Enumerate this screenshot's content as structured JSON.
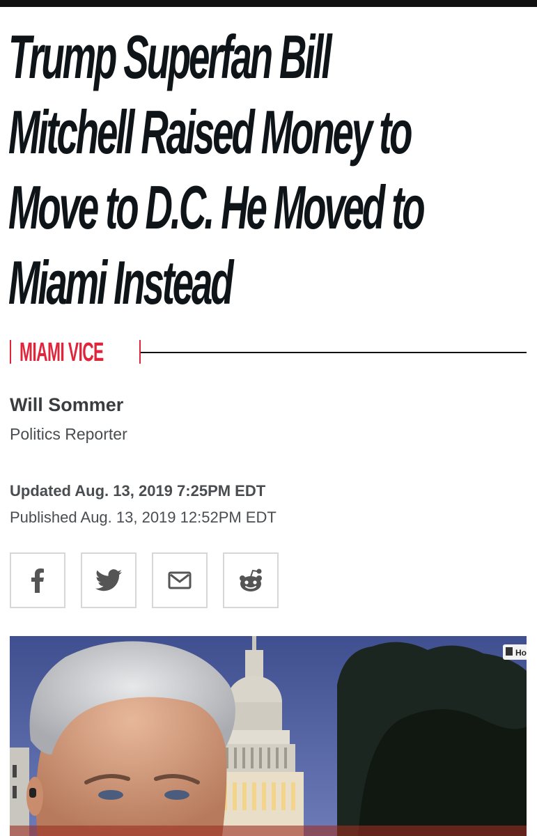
{
  "article": {
    "headline_lines": [
      "Trump Superfan Bill",
      "Mitchell Raised Money to",
      "Move to D.C. He Moved to",
      "Miami Instead"
    ],
    "rubric": "MIAMI VICE",
    "author": {
      "name": "Will Sommer",
      "title": "Politics Reporter"
    },
    "updated": "Updated Aug. 13, 2019 7:25PM EDT",
    "published": "Published Aug. 13, 2019 12:52PM EDT"
  },
  "share": [
    {
      "name": "facebook",
      "icon": "facebook-icon"
    },
    {
      "name": "twitter",
      "icon": "twitter-icon"
    },
    {
      "name": "email",
      "icon": "envelope-icon"
    },
    {
      "name": "reddit",
      "icon": "reddit-icon"
    }
  ],
  "hero_image": {
    "corner_badge": "Ho"
  },
  "colors": {
    "accent": "#e0243a",
    "headline": "#0e1417",
    "meta_text": "#4a4d50",
    "share_icon": "#555555",
    "share_border": "#d7d7d7"
  }
}
